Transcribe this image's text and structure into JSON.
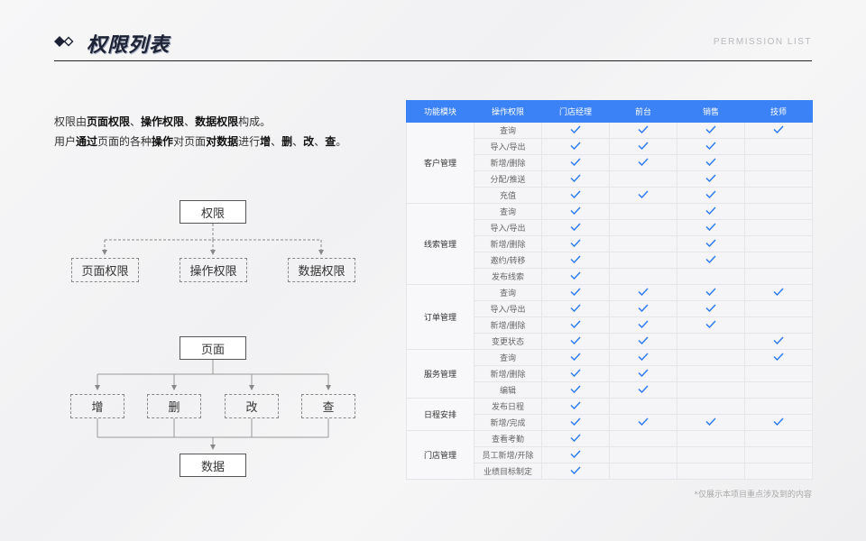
{
  "header": {
    "title": "权限列表",
    "subtitle": "PERMISSION  LIST"
  },
  "intro": {
    "line1": [
      {
        "text": "权限由",
        "bold": false
      },
      {
        "text": "页面权限",
        "bold": true
      },
      {
        "text": "、",
        "bold": false
      },
      {
        "text": "操作权限",
        "bold": true
      },
      {
        "text": "、",
        "bold": false
      },
      {
        "text": "数据权限",
        "bold": true
      },
      {
        "text": "构成。",
        "bold": false
      }
    ],
    "line2": [
      {
        "text": "用户",
        "bold": false
      },
      {
        "text": "通过",
        "bold": true
      },
      {
        "text": "页面的各种",
        "bold": false
      },
      {
        "text": "操作",
        "bold": true
      },
      {
        "text": "对页面",
        "bold": false
      },
      {
        "text": "对数据",
        "bold": true
      },
      {
        "text": "进行",
        "bold": false
      },
      {
        "text": "增",
        "bold": true
      },
      {
        "text": "、",
        "bold": false
      },
      {
        "text": "删",
        "bold": true
      },
      {
        "text": "、",
        "bold": false
      },
      {
        "text": "改",
        "bold": true
      },
      {
        "text": "、",
        "bold": false
      },
      {
        "text": "查",
        "bold": true
      },
      {
        "text": "。",
        "bold": false
      }
    ]
  },
  "diagram": {
    "root": "权限",
    "types": [
      "页面权限",
      "操作权限",
      "数据权限"
    ],
    "page": "页面",
    "ops": [
      "增",
      "删",
      "改",
      "查"
    ],
    "data": "数据"
  },
  "table": {
    "columns": [
      "功能模块",
      "操作权限",
      "门店经理",
      "前台",
      "销售",
      "技师"
    ],
    "groups": [
      {
        "module": "客户管理",
        "rows": [
          {
            "action": "查询",
            "checks": [
              true,
              true,
              true,
              true
            ]
          },
          {
            "action": "导入/导出",
            "checks": [
              true,
              true,
              true,
              false
            ]
          },
          {
            "action": "新增/删除",
            "checks": [
              true,
              true,
              true,
              false
            ]
          },
          {
            "action": "分配/推送",
            "checks": [
              true,
              false,
              true,
              false
            ]
          },
          {
            "action": "充值",
            "checks": [
              true,
              true,
              true,
              false
            ]
          }
        ]
      },
      {
        "module": "线索管理",
        "rows": [
          {
            "action": "查询",
            "checks": [
              true,
              false,
              true,
              false
            ]
          },
          {
            "action": "导入/导出",
            "checks": [
              true,
              false,
              true,
              false
            ]
          },
          {
            "action": "新增/删除",
            "checks": [
              true,
              false,
              true,
              false
            ]
          },
          {
            "action": "邀约/转移",
            "checks": [
              true,
              false,
              true,
              false
            ]
          },
          {
            "action": "发布线索",
            "checks": [
              true,
              false,
              false,
              false
            ]
          }
        ]
      },
      {
        "module": "订单管理",
        "rows": [
          {
            "action": "查询",
            "checks": [
              true,
              true,
              true,
              true
            ]
          },
          {
            "action": "导入/导出",
            "checks": [
              true,
              true,
              true,
              false
            ]
          },
          {
            "action": "新增/删除",
            "checks": [
              true,
              true,
              true,
              false
            ]
          },
          {
            "action": "变更状态",
            "checks": [
              true,
              true,
              false,
              true
            ]
          }
        ]
      },
      {
        "module": "服务管理",
        "rows": [
          {
            "action": "查询",
            "checks": [
              true,
              true,
              false,
              true
            ]
          },
          {
            "action": "新增/删除",
            "checks": [
              true,
              true,
              false,
              false
            ]
          },
          {
            "action": "编辑",
            "checks": [
              true,
              true,
              false,
              false
            ]
          }
        ]
      },
      {
        "module": "日程安排",
        "rows": [
          {
            "action": "发布日程",
            "checks": [
              true,
              false,
              false,
              false
            ]
          },
          {
            "action": "新增/完成",
            "checks": [
              true,
              true,
              true,
              true
            ]
          }
        ]
      },
      {
        "module": "门店管理",
        "rows": [
          {
            "action": "查看考勤",
            "checks": [
              true,
              false,
              false,
              false
            ]
          },
          {
            "action": "员工新增/开除",
            "checks": [
              true,
              false,
              false,
              false
            ]
          },
          {
            "action": "业绩目标制定",
            "checks": [
              true,
              false,
              false,
              false
            ]
          }
        ]
      }
    ]
  },
  "footnote": "*仅展示本项目重点涉及到的内容",
  "colors": {
    "header_blue": "#3b82f6",
    "check_blue": "#2f7cf0",
    "title_dark": "#1c2233"
  },
  "icons": {
    "title_mark": "diamond-pair-icon",
    "check": "checkmark-icon"
  }
}
